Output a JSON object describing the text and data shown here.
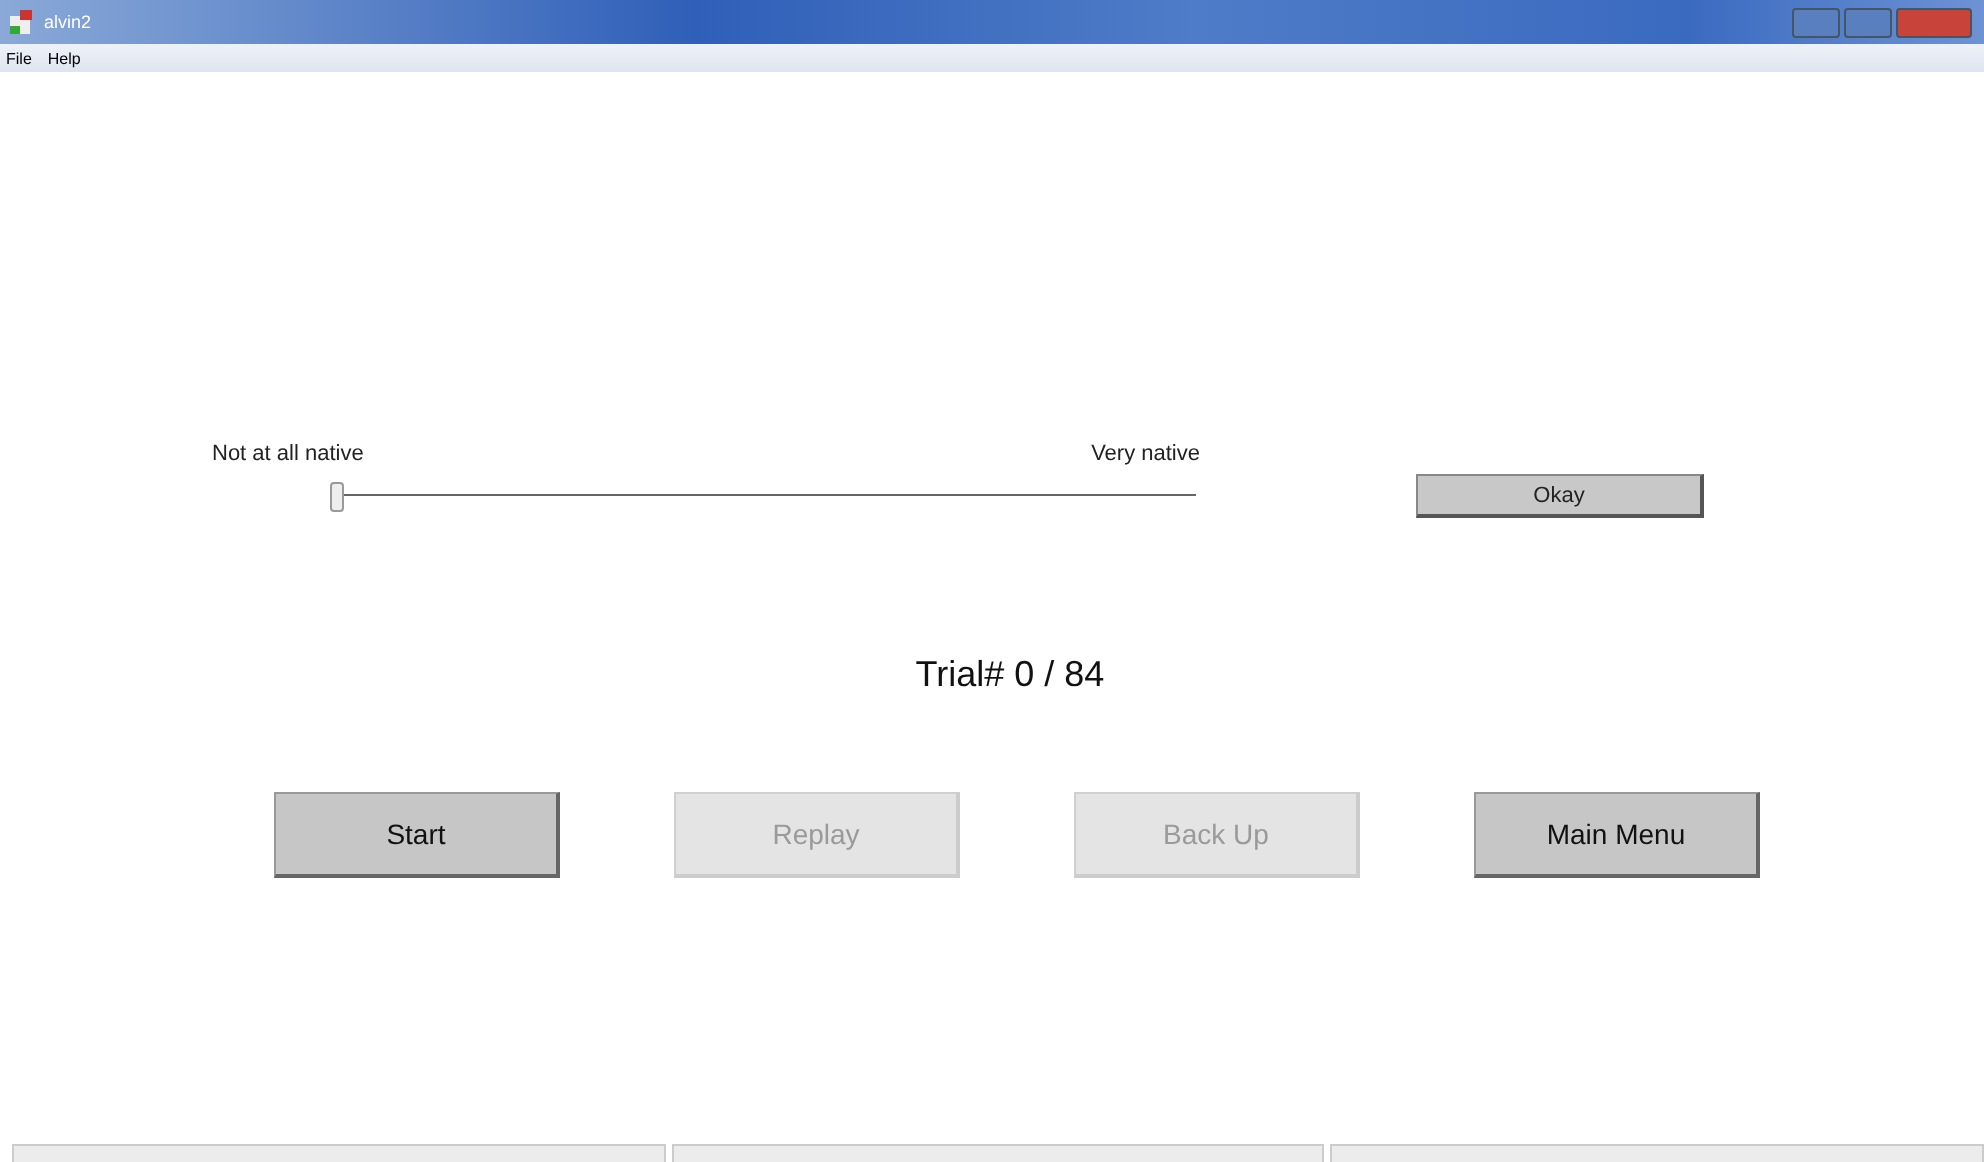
{
  "window": {
    "title": "alvin2"
  },
  "menu": [
    "File",
    "Help"
  ],
  "rating": {
    "left_label": "Not at all native",
    "right_label": "Very native",
    "level": 0
  },
  "okay_button": {
    "label": "Okay",
    "disabled": false
  },
  "trial": "Trial# 0 / 84",
  "buttons": [
    {
      "label": "Start",
      "disabled": false
    },
    {
      "label": "Replay",
      "disabled": true
    },
    {
      "label": "Back Up",
      "disabled": true
    },
    {
      "label": "Main Menu",
      "disabled": false
    }
  ]
}
